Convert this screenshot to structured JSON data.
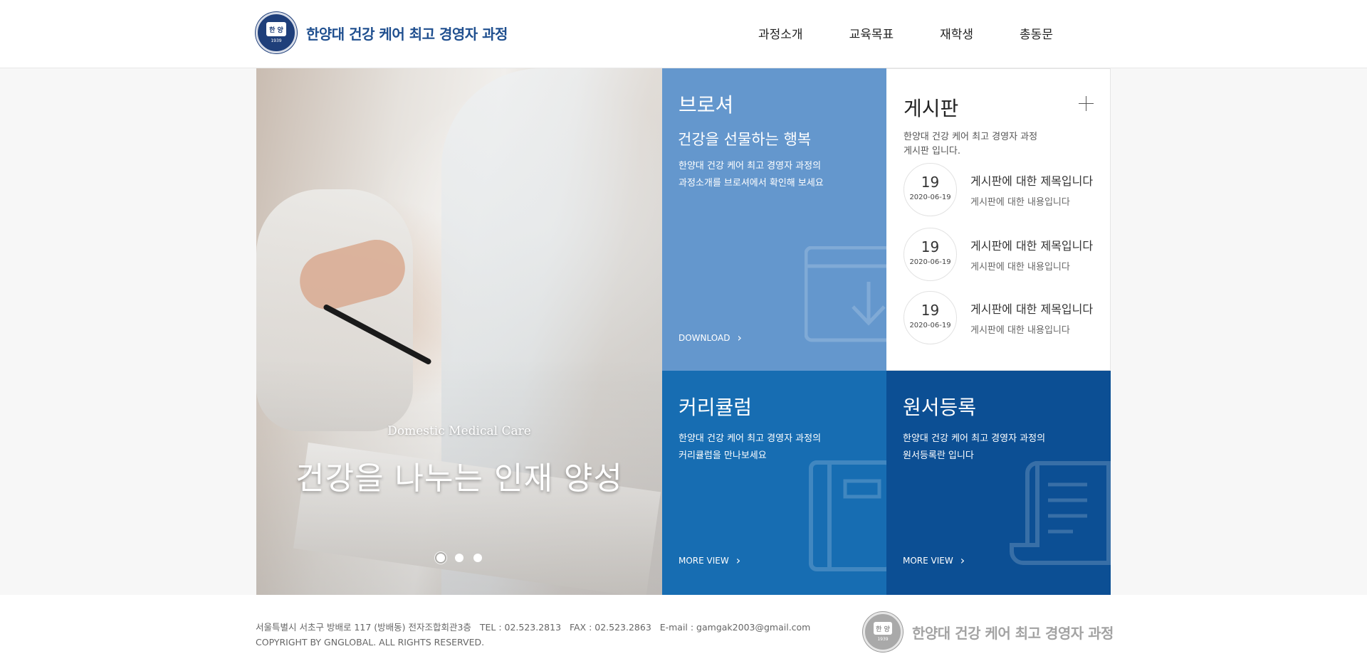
{
  "header": {
    "logo_text": "한양대 건강 케어 최고 경영자 과정",
    "emblem_text": "한 양",
    "emblem_year": "1939",
    "nav": [
      {
        "label": "과정소개"
      },
      {
        "label": "교육목표"
      },
      {
        "label": "재학생"
      },
      {
        "label": "총동문"
      }
    ]
  },
  "hero": {
    "subtitle": "Domestic Medical Care",
    "title": "건강을 나누는 인재 양성",
    "slides": 3,
    "active_slide": 1
  },
  "brochure": {
    "title": "브로셔",
    "subtitle": "건강을 선물하는 행복",
    "desc_line1": "한양대 건강 케어 최고 경영자 과정의",
    "desc_line2": "과정소개를 브로셔에서 확인해 보세요",
    "link": "DOWNLOAD",
    "color": "#6497cd"
  },
  "board": {
    "title": "게시판",
    "intro_line1": "한양대 건강 케어 최고 경영자 과정",
    "intro_line2": "게시판 입니다.",
    "posts": [
      {
        "day": "19",
        "date": "2020-06-19",
        "title": "게시판에 대한 제목입니다",
        "body": "게시판에 대한 내용입니다"
      },
      {
        "day": "19",
        "date": "2020-06-19",
        "title": "게시판에 대한 제목입니다",
        "body": "게시판에 대한 내용입니다"
      },
      {
        "day": "19",
        "date": "2020-06-19",
        "title": "게시판에 대한 제목입니다",
        "body": "게시판에 대한 내용입니다"
      }
    ]
  },
  "curriculum": {
    "title": "커리큘럼",
    "desc_line1": "한양대 건강 케어 최고 경영자 과정의",
    "desc_line2": "커리큘럼을 만나보세요",
    "link": "MORE VIEW",
    "color": "#176db2"
  },
  "apply": {
    "title": "원서등록",
    "desc_line1": "한양대 건강 케어 최고 경영자 과정의",
    "desc_line2": "원서등록란 입니다",
    "link": "MORE VIEW",
    "color": "#0c4f94"
  },
  "footer": {
    "address": "서울특별시 서초구 방배로 117 (방배동) 전자조합회관3층   TEL : 02.523.2813   FAX : 02.523.2863   E-mail : gamgak2003@gmail.com",
    "copyright": "COPYRIGHT BY GNGLOBAL. ALL RIGHTS RESERVED.",
    "logo_text": "한양대 건강 케어 최고 경영자 과정"
  }
}
